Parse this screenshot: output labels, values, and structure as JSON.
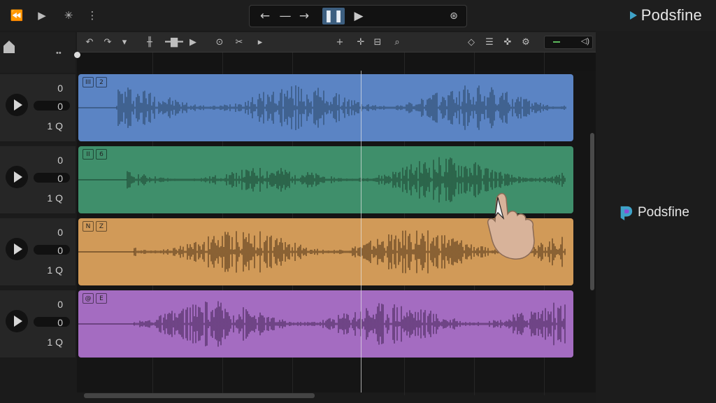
{
  "app": {
    "brand": "Podsfine"
  },
  "toolbar": {
    "icons": [
      "rewind-icon",
      "play-icon",
      "asterisk-icon",
      "more-vertical-icon"
    ]
  },
  "transport": {
    "icons": [
      "back-arrow-icon",
      "loop-icon",
      "forward-arrow-icon",
      "pause-icon",
      "play-icon",
      "mask-icon"
    ]
  },
  "tracks": [
    {
      "values": [
        "0",
        "0",
        "1 Q"
      ],
      "color": "#5b84c4",
      "wave": "#2f4b6e",
      "badges": [
        "III",
        "2"
      ]
    },
    {
      "values": [
        "0",
        "0",
        "1 Q"
      ],
      "color": "#3f8f6b",
      "wave": "#1f4a36",
      "badges": [
        "II",
        "6"
      ]
    },
    {
      "values": [
        "0",
        "0",
        "1 Q"
      ],
      "color": "#d19a58",
      "wave": "#5a3c1c",
      "badges": [
        "N",
        "Z"
      ]
    },
    {
      "values": [
        "0",
        "0",
        "1 Q"
      ],
      "color": "#a46cc1",
      "wave": "#4c2b5e",
      "badges": [
        "@",
        "E"
      ]
    }
  ],
  "colors": {
    "accent": "#3fa2c8",
    "pause": "#3d5f80"
  }
}
